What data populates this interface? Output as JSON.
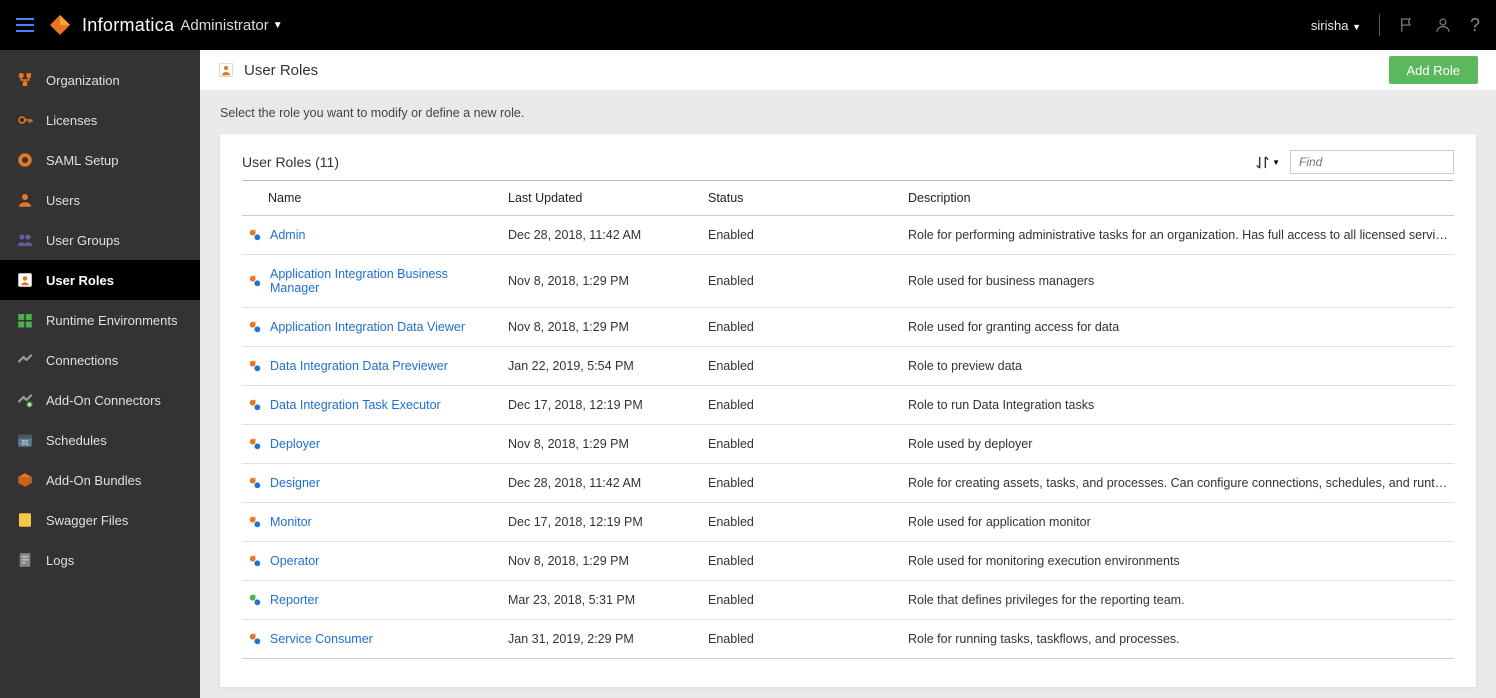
{
  "header": {
    "brand": "Informatica",
    "product": "Administrator",
    "username": "sirisha"
  },
  "sidebar": {
    "items": [
      {
        "label": "Organization"
      },
      {
        "label": "Licenses"
      },
      {
        "label": "SAML Setup"
      },
      {
        "label": "Users"
      },
      {
        "label": "User Groups"
      },
      {
        "label": "User Roles"
      },
      {
        "label": "Runtime Environments"
      },
      {
        "label": "Connections"
      },
      {
        "label": "Add-On Connectors"
      },
      {
        "label": "Schedules"
      },
      {
        "label": "Add-On Bundles"
      },
      {
        "label": "Swagger Files"
      },
      {
        "label": "Logs"
      }
    ]
  },
  "page": {
    "title": "User Roles",
    "add_label": "Add Role",
    "subtext": "Select the role you want to modify or define a new role."
  },
  "panel": {
    "title": "User Roles (11)",
    "find_placeholder": "Find",
    "columns": {
      "name": "Name",
      "updated": "Last Updated",
      "status": "Status",
      "desc": "Description"
    }
  },
  "rows": [
    {
      "name": "Admin",
      "updated": "Dec 28, 2018, 11:42 AM",
      "status": "Enabled",
      "desc": "Role for performing administrative tasks for an organization. Has full access to all licensed services."
    },
    {
      "name": "Application Integration Business Manager",
      "updated": "Nov 8, 2018, 1:29 PM",
      "status": "Enabled",
      "desc": "Role used for business managers"
    },
    {
      "name": "Application Integration Data Viewer",
      "updated": "Nov 8, 2018, 1:29 PM",
      "status": "Enabled",
      "desc": "Role used for granting access for data"
    },
    {
      "name": "Data Integration Data Previewer",
      "updated": "Jan 22, 2019, 5:54 PM",
      "status": "Enabled",
      "desc": "Role to preview data"
    },
    {
      "name": "Data Integration Task Executor",
      "updated": "Dec 17, 2018, 12:19 PM",
      "status": "Enabled",
      "desc": "Role to run Data Integration tasks"
    },
    {
      "name": "Deployer",
      "updated": "Nov 8, 2018, 1:29 PM",
      "status": "Enabled",
      "desc": "Role used by deployer"
    },
    {
      "name": "Designer",
      "updated": "Dec 28, 2018, 11:42 AM",
      "status": "Enabled",
      "desc": "Role for creating assets, tasks, and processes. Can configure connections, schedules, and runtime environ..."
    },
    {
      "name": "Monitor",
      "updated": "Dec 17, 2018, 12:19 PM",
      "status": "Enabled",
      "desc": "Role used for application monitor"
    },
    {
      "name": "Operator",
      "updated": "Nov 8, 2018, 1:29 PM",
      "status": "Enabled",
      "desc": "Role used for monitoring execution environments"
    },
    {
      "name": "Reporter",
      "updated": "Mar 23, 2018, 5:31 PM",
      "status": "Enabled",
      "desc": "Role that defines privileges for the reporting team."
    },
    {
      "name": "Service Consumer",
      "updated": "Jan 31, 2019, 2:29 PM",
      "status": "Enabled",
      "desc": "Role for running tasks, taskflows, and processes."
    }
  ]
}
